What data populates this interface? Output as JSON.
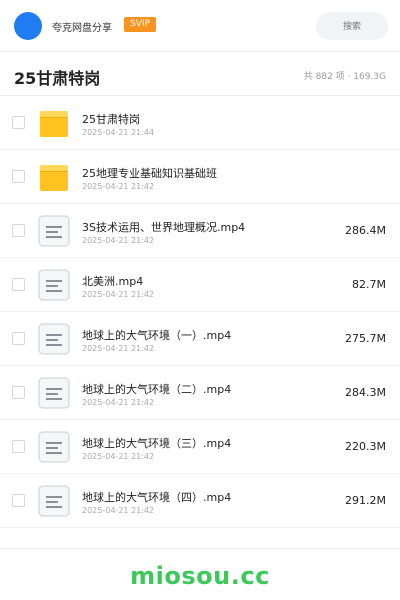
{
  "header": {
    "site_name": "夸克网盘分享",
    "badge": "SVIP",
    "search_placeholder": "搜索"
  },
  "folder": {
    "title": "25甘肃特岗",
    "summary": "共 882 项 · 169.3G"
  },
  "items": [
    {
      "type": "folder",
      "name": "25甘肃特岗",
      "date": "2025-04-21 21:44",
      "size": ""
    },
    {
      "type": "folder",
      "name": "25地理专业基础知识基础班",
      "date": "2025-04-21 21:42",
      "size": ""
    },
    {
      "type": "file",
      "name": "3S技术运用、世界地理概况.mp4",
      "date": "2025-04-21 21:42",
      "size": "286.4M"
    },
    {
      "type": "file",
      "name": "北美洲.mp4",
      "date": "2025-04-21 21:42",
      "size": "82.7M"
    },
    {
      "type": "file",
      "name": "地球上的大气环境（一）.mp4",
      "date": "2025-04-21 21:42",
      "size": "275.7M"
    },
    {
      "type": "file",
      "name": "地球上的大气环境（二）.mp4",
      "date": "2025-04-21 21:42",
      "size": "284.3M"
    },
    {
      "type": "file",
      "name": "地球上的大气环境（三）.mp4",
      "date": "2025-04-21 21:42",
      "size": "220.3M"
    },
    {
      "type": "file",
      "name": "地球上的大气环境（四）.mp4",
      "date": "2025-04-21 21:42",
      "size": "291.2M"
    }
  ],
  "footer": {
    "watermark": "miosou.cc"
  },
  "colors": {
    "avatar": "#1f7cf2",
    "badge": "#f7931e",
    "folder_icon": "#ffc21e",
    "watermark": "#3cc95a"
  }
}
